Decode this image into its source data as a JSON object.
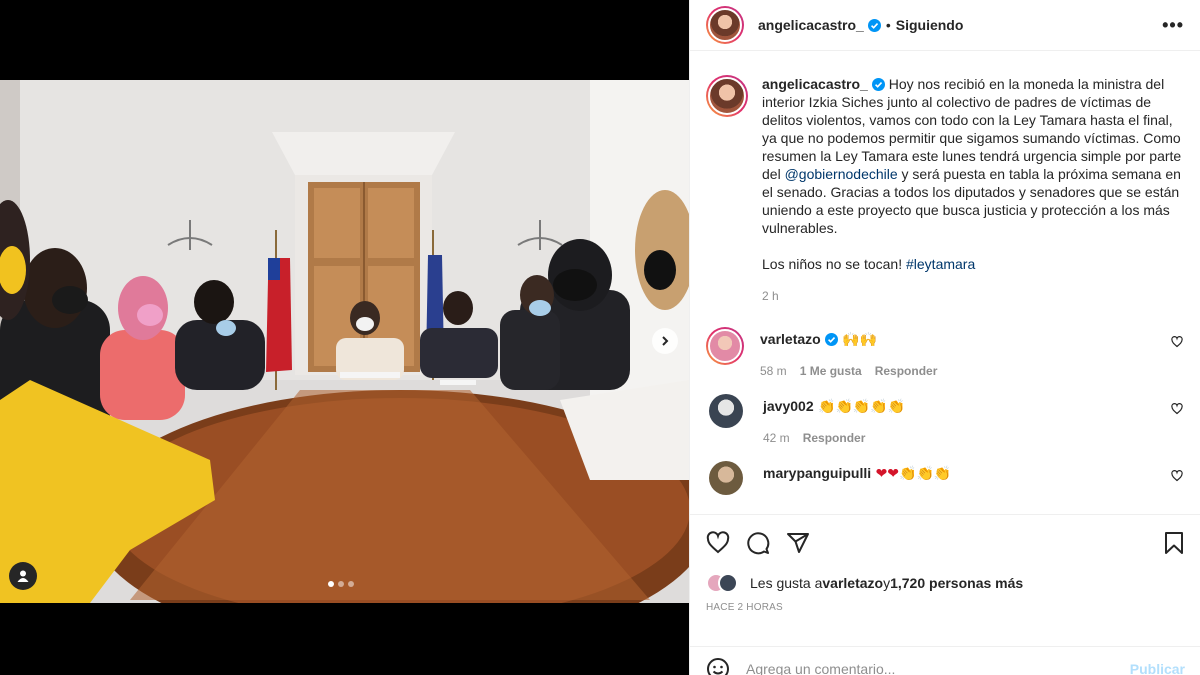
{
  "post": {
    "author": "angelicacastro_",
    "separator": "•",
    "follow_state": "Siguiendo",
    "more_label": "•••",
    "caption_part1": " Hoy nos recibió en la moneda la ministra del interior Izkia Siches junto al colectivo de padres de víctimas de delitos violentos, vamos con todo con la Ley Tamara hasta el final, ya que no podemos permitir que sigamos sumando víctimas. Como resumen la Ley Tamara este lunes tendrá urgencia simple por parte del ",
    "caption_mention": "@gobiernodechile",
    "caption_part2": " y será puesta en tabla la próxima semana en el senado. Gracias a todos los diputados y senadores que se están uniendo a este proyecto que busca justicia y protección a los más vulnerables.",
    "caption_last": "Los niños no se tocan! ",
    "caption_hashtag": "#leytamara",
    "caption_time": "2 h"
  },
  "comments": [
    {
      "user": "varletazo",
      "verified": true,
      "text": " 🙌🙌",
      "time": "58 m",
      "likes": "1 Me gusta",
      "reply": "Responder"
    },
    {
      "user": "javy002",
      "verified": false,
      "text": " 👏👏👏👏👏",
      "time": "42 m",
      "likes": "",
      "reply": "Responder"
    },
    {
      "user": "marypanguipulli",
      "verified": false,
      "text": " ❤❤👏👏👏",
      "time": "",
      "likes": "",
      "reply": ""
    }
  ],
  "likes": {
    "prefix": "Les gusta a ",
    "user": "varletazo",
    "middle": " y ",
    "count": "1,720 personas más"
  },
  "timestamp": "HACE 2 HORAS",
  "composer": {
    "placeholder": "Agrega un comentario...",
    "publish": "Publicar"
  },
  "carousel": {
    "current": 1,
    "total": 3
  },
  "colors": {
    "accent": "#0095f6",
    "link": "#00376b",
    "muted": "#8e8e8e",
    "publish_disabled": "#b2dffc"
  },
  "icons": [
    "verified-icon",
    "more-icon",
    "heart-icon",
    "comment-icon",
    "share-icon",
    "bookmark-icon",
    "emoji-icon",
    "chevron-right-icon",
    "user-tag-icon"
  ]
}
